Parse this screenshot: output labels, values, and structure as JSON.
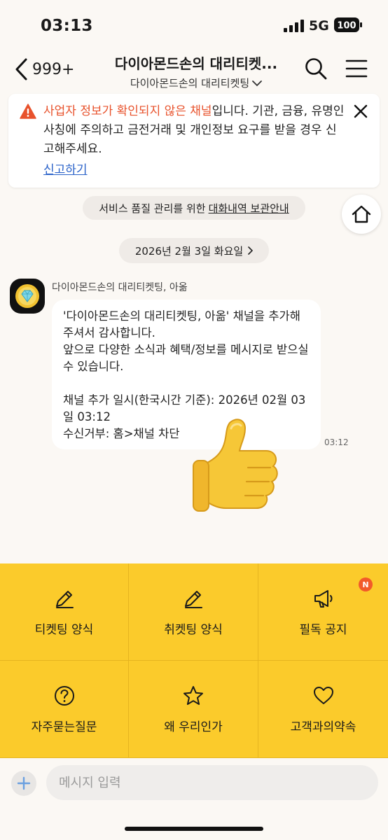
{
  "status_bar": {
    "time": "03:13",
    "network": "5G",
    "battery": "100"
  },
  "header": {
    "back_count": "999+",
    "title": "다이아몬드손의 대리티켓...",
    "subtitle": "다이아몬드손의 대리티켓팅"
  },
  "warning": {
    "emphasis": "사업자 정보가 확인되지 않은 채널",
    "message": "입니다. 기관, 금융, 유명인 사칭에 주의하고 금전거래 및 개인정보 요구를 받을 경우 신고해주세요.",
    "report_link": "신고하기"
  },
  "notice": {
    "text": "서비스 품질 관리를 위한",
    "link": "대화내역 보관안내"
  },
  "date_divider": "2026년 2월 3일 화요일",
  "message": {
    "sender": "다이아몬드손의 대리티켓팅, 아옮",
    "text": "'다이아몬드손의 대리티켓팅, 아옮' 채널을 추가해 주셔서 감사합니다.\n앞으로 다양한 소식과 혜택/정보를 메시지로 받으실 수 있습니다.\n\n채널 추가 일시(한국시간 기준): 2026년 02월 03일 03:12\n수신거부: 홈>채널 차단",
    "time": "03:12"
  },
  "menu": {
    "items": [
      {
        "label": "티켓팅 양식",
        "icon": "pencil-icon"
      },
      {
        "label": "취켓팅 양식",
        "icon": "pencil-icon"
      },
      {
        "label": "필독 공지",
        "icon": "megaphone-icon",
        "badge": "N"
      },
      {
        "label": "자주묻는질문",
        "icon": "question-circle-icon"
      },
      {
        "label": "왜 우리인가",
        "icon": "star-icon"
      },
      {
        "label": "고객과의약속",
        "icon": "heart-icon"
      }
    ]
  },
  "input": {
    "placeholder": "메시지 입력"
  },
  "colors": {
    "accent_yellow": "#fbcb2b",
    "warning_orange": "#e8522c",
    "link_blue": "#2a62c9",
    "badge": "#f25a2a"
  }
}
